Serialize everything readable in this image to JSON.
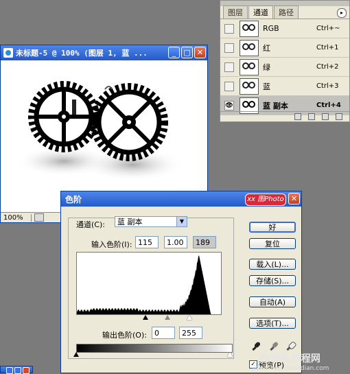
{
  "channels_panel": {
    "tabs": [
      "图层",
      "通道",
      "路径"
    ],
    "active_tab": 1,
    "rows": [
      {
        "name": "RGB",
        "shortcut": "Ctrl+~",
        "visible": false,
        "selected": false
      },
      {
        "name": "红",
        "shortcut": "Ctrl+1",
        "visible": false,
        "selected": false
      },
      {
        "name": "绿",
        "shortcut": "Ctrl+2",
        "visible": false,
        "selected": false
      },
      {
        "name": "蓝",
        "shortcut": "Ctrl+3",
        "visible": false,
        "selected": false
      },
      {
        "name": "蓝 副本",
        "shortcut": "Ctrl+4",
        "visible": true,
        "selected": true
      }
    ]
  },
  "document": {
    "title": "未标题-5 @ 100% (图层 1, 蓝 ...",
    "zoom": "100%",
    "min_glyph": "_",
    "max_glyph": "□",
    "close_glyph": "✕"
  },
  "levels": {
    "title": "色阶",
    "badge": "xx 图Photo",
    "channel_label": "通道(C):",
    "channel_value": "蓝 副本",
    "input_label": "输入色阶(I):",
    "input_values": [
      "115",
      "1.00",
      "189"
    ],
    "output_label": "输出色阶(O):",
    "output_values": [
      "0",
      "255"
    ],
    "buttons": [
      "好",
      "复位",
      "载入(L)...",
      "存储(S)...",
      "自动(A)",
      "选项(T)..."
    ],
    "preview_label": "预览(P)",
    "preview_checked": true,
    "histogram_levels": {
      "black_point": 115,
      "gamma": 1.0,
      "white_point": 189
    }
  },
  "watermark": {
    "text": "查字典 教程网",
    "url": "jiaocheng.chazidian.com"
  },
  "colors": {
    "desktop": "#7b7b7b",
    "title_blue": "#2459c9",
    "close_red": "#d14a2b",
    "dialog_bg": "#ece9d8"
  }
}
